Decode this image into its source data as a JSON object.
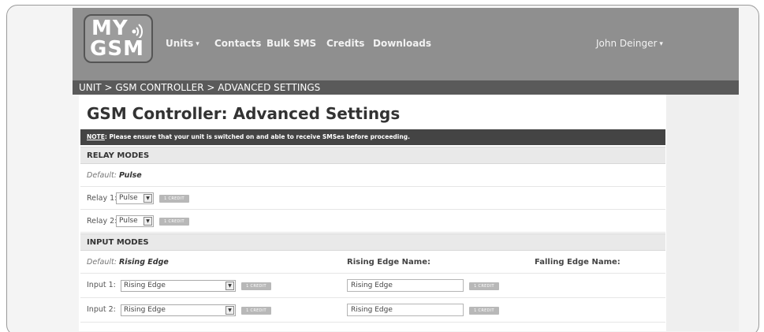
{
  "logo": {
    "line1": "MY",
    "line2": "GSM"
  },
  "nav": {
    "items": [
      {
        "label": "Units",
        "caret": "▾"
      },
      {
        "label": "Contacts"
      },
      {
        "label": "Bulk SMS"
      },
      {
        "label": "Credits"
      },
      {
        "label": "Downloads"
      }
    ],
    "user": {
      "label": "John Deinger",
      "caret": "▾"
    }
  },
  "breadcrumb": "UNIT > GSM CONTROLLER > ADVANCED SETTINGS",
  "page_title": "GSM Controller: Advanced Settings",
  "note": {
    "label": "NOTE",
    "text": ": Please ensure that your unit is switched on and able to receive SMSes before proceeding."
  },
  "relay_modes": {
    "heading": "RELAY MODES",
    "default_label": "Default:",
    "default_value": "Pulse",
    "relays": [
      {
        "label": "Relay 1:",
        "value": "Pulse",
        "button": "1 CREDIT"
      },
      {
        "label": "Relay 2:",
        "value": "Pulse",
        "button": "1 CREDIT"
      }
    ]
  },
  "input_modes": {
    "heading": "INPUT MODES",
    "default_label": "Default:",
    "default_value": "Rising Edge",
    "rising_edge_name_header": "Rising Edge Name:",
    "falling_edge_name_header": "Falling Edge Name:",
    "inputs": [
      {
        "label": "Input 1:",
        "value": "Rising Edge",
        "button": "1 CREDIT",
        "rising_name": "Rising Edge",
        "rising_button": "1 CREDIT"
      },
      {
        "label": "Input 2:",
        "value": "Rising Edge",
        "button": "1 CREDIT",
        "rising_name": "Rising Edge",
        "rising_button": "1 CREDIT"
      }
    ]
  },
  "icons": {
    "dropdown": "▾",
    "select_arrow": "▼"
  }
}
